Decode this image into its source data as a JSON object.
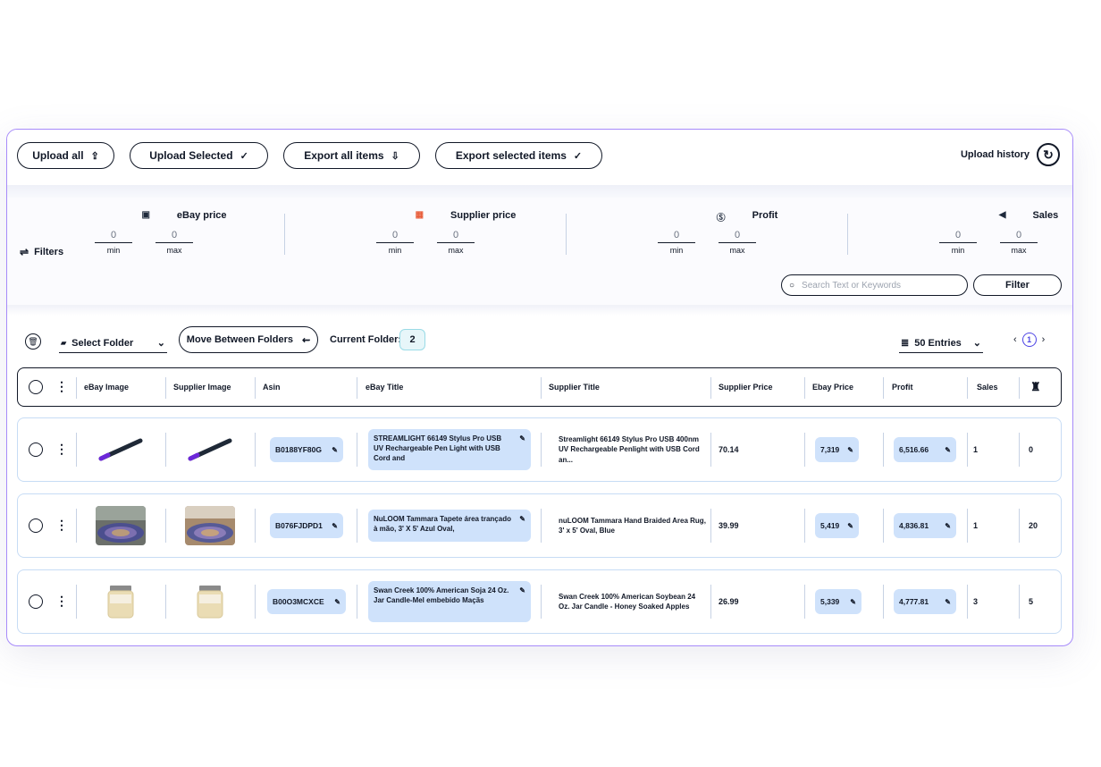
{
  "toolbar": {
    "upload_all": "Upload all",
    "upload_selected": "Upload Selected",
    "export_all": "Export all items",
    "export_selected": "Export selected items",
    "upload_history": "Upload history"
  },
  "filters": {
    "label": "Filters",
    "groups": [
      {
        "title": "eBay price",
        "min": "0",
        "max": "0"
      },
      {
        "title": "Supplier price",
        "min": "0",
        "max": "0"
      },
      {
        "title": "Profit",
        "min": "0",
        "max": "0"
      },
      {
        "title": "Sales",
        "min": "0",
        "max": "0"
      }
    ],
    "min_label": "min",
    "max_label": "max",
    "search_placeholder": "Search Text or Keywords",
    "filter_button": "Filter"
  },
  "folders": {
    "select_folder": "Select Folder",
    "move_between": "Move Between Folders",
    "current_folder_label": "Current Folder:",
    "current_folder_value": "2",
    "entries": "50 Entries",
    "page": "1"
  },
  "table": {
    "headers": [
      "eBay Image",
      "Supplier Image",
      "Asin",
      "eBay Title",
      "Supplier Title",
      "Supplier Price",
      "Ebay Price",
      "Profit",
      "Sales"
    ],
    "rows": [
      {
        "asin": "B0188YF80G",
        "ebay_title": "STREAMLIGHT 66149 Stylus Pro USB UV Rechargeable Pen Light with USB Cord and",
        "supplier_title": "Streamlight 66149 Stylus Pro USB 400nm UV Rechargeable Penlight with USB Cord an...",
        "supplier_price": "70.14",
        "ebay_price": "7,319",
        "profit": "6,516.66",
        "sales": "1",
        "last": "0",
        "image": "flashlight"
      },
      {
        "asin": "B076FJDPD1",
        "ebay_title": "NuLOOM Tammara Tapete área trançado à mão, 3' X 5' Azul Oval,",
        "supplier_title": "nuLOOM Tammara Hand Braided Area Rug, 3' x 5' Oval, Blue",
        "supplier_price": "39.99",
        "ebay_price": "5,419",
        "profit": "4,836.81",
        "sales": "1",
        "last": "20",
        "image": "rug"
      },
      {
        "asin": "B00O3MCXCE",
        "ebay_title": "Swan Creek 100% American Soja 24 Oz. Jar Candle-Mel embebido Maçãs",
        "supplier_title": "Swan Creek 100% American Soybean 24 Oz. Jar Candle - Honey Soaked Apples",
        "supplier_price": "26.99",
        "ebay_price": "5,339",
        "profit": "4,777.81",
        "sales": "3",
        "last": "5",
        "image": "candle"
      }
    ]
  },
  "colors": {
    "frame_border": "#a78bfa",
    "chip_bg": "#cfe2fb",
    "row_border": "#c7dcf5",
    "pager_accent": "#4f46e5"
  }
}
